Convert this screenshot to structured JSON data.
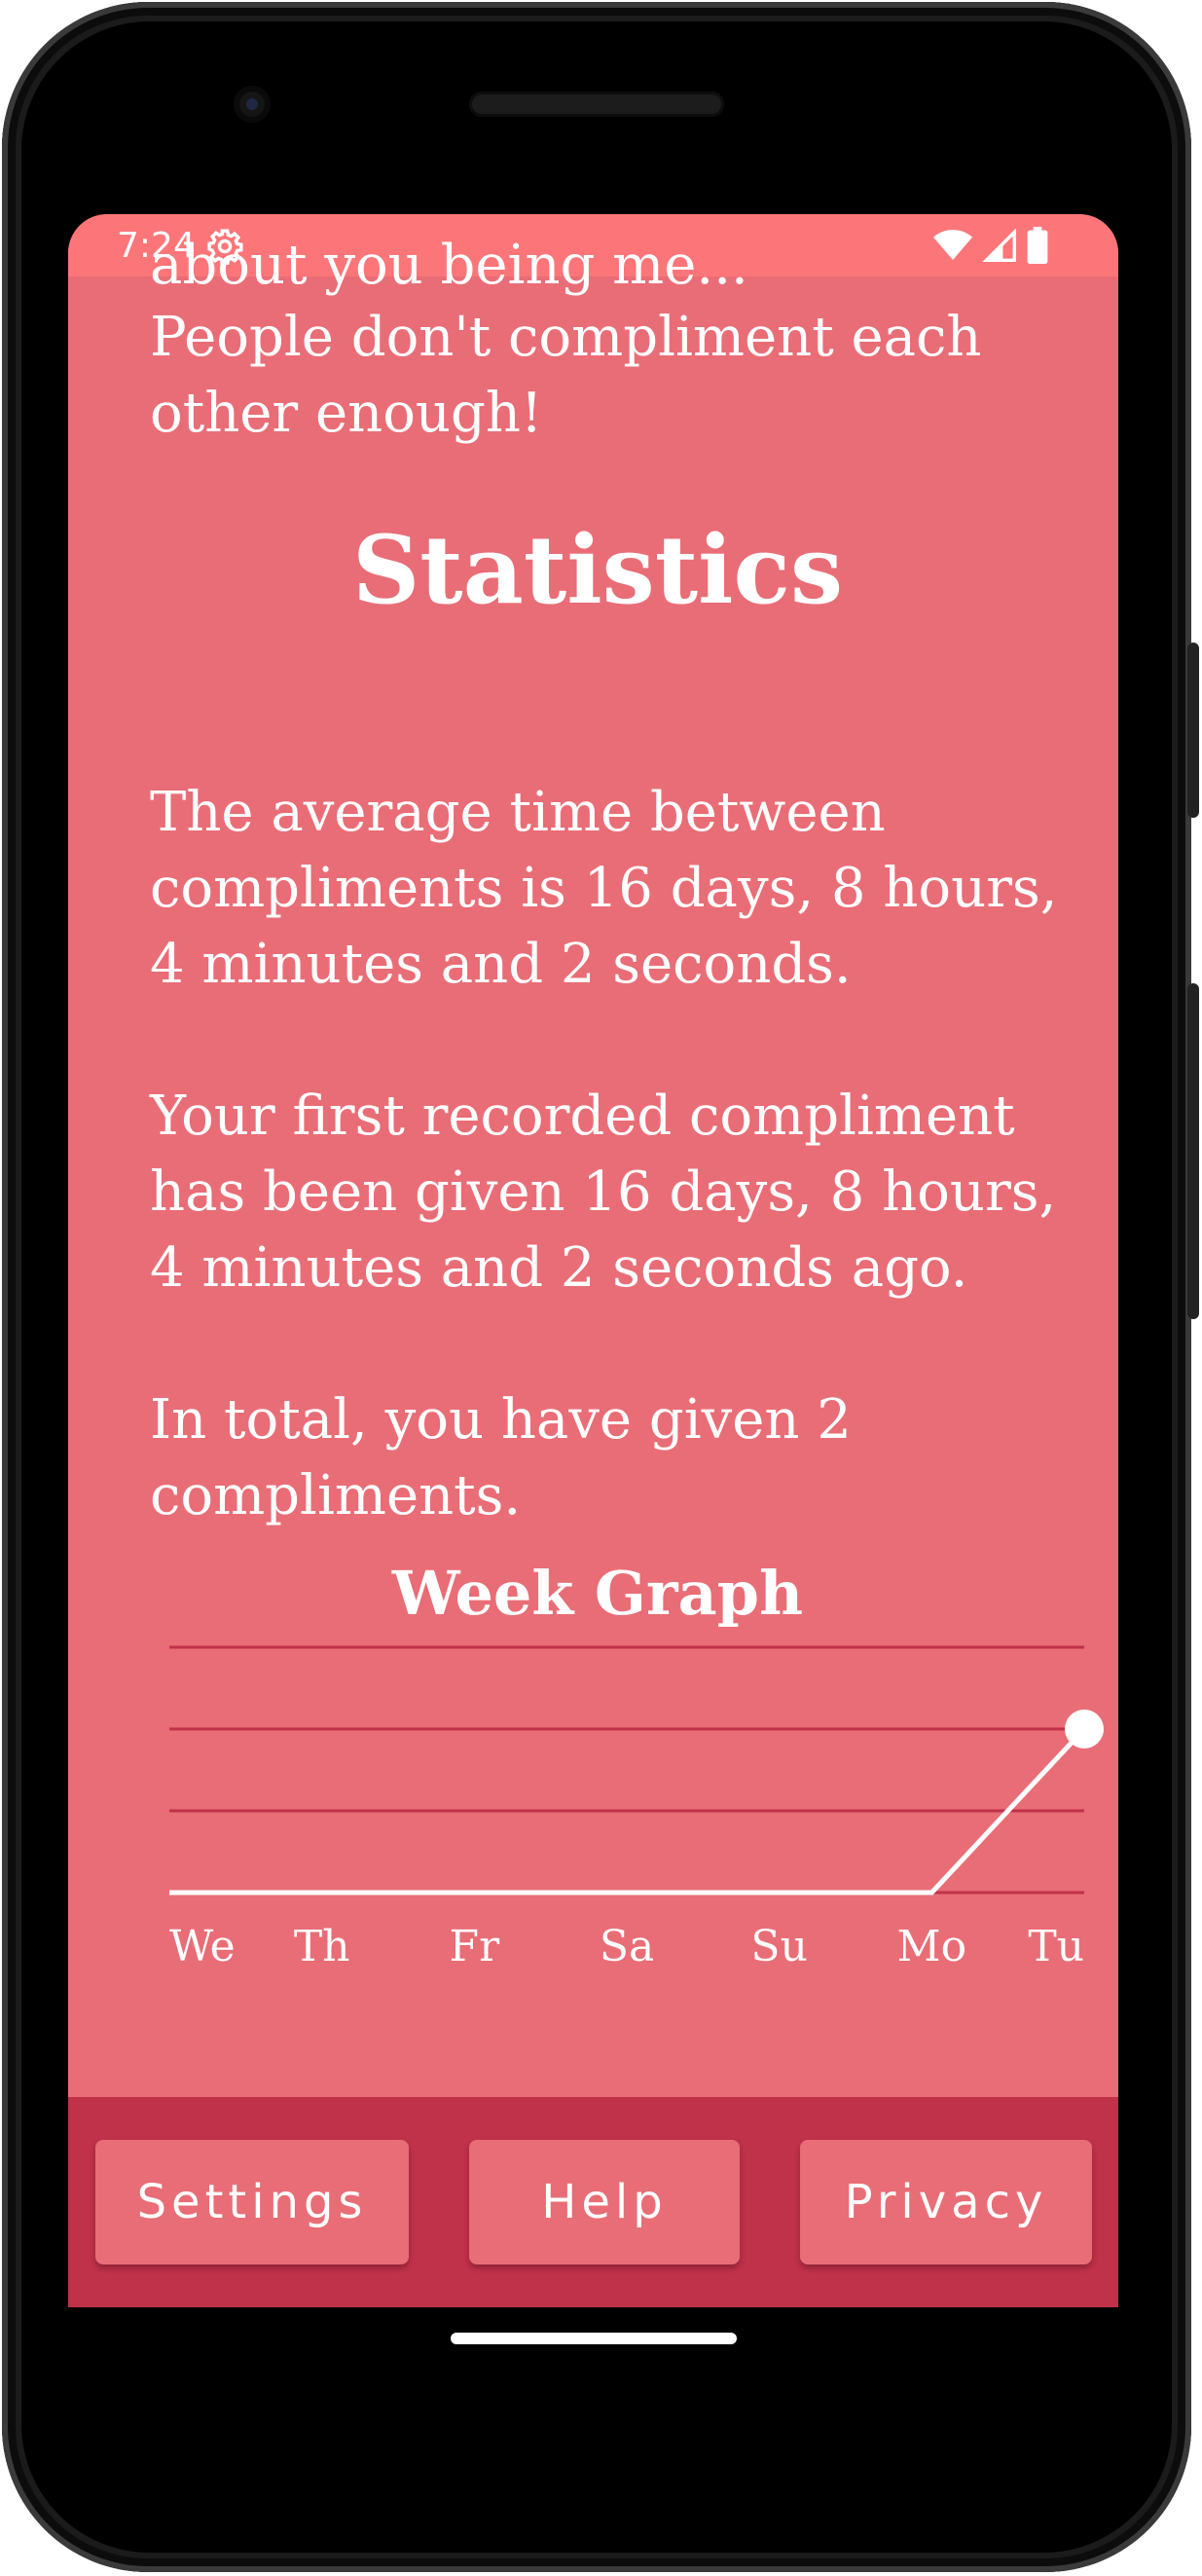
{
  "status_bar": {
    "time": "7:24",
    "icons": [
      "gear-icon",
      "wifi-icon",
      "signal-icon",
      "battery-icon"
    ]
  },
  "content": {
    "cut_off_line": "about you being me...",
    "intro": "People don't compliment each\nother enough!",
    "statistics_heading": "Statistics",
    "avg_time": "The average time between\ncompliments is 16 days, 8 hours,\n4 minutes and 2 seconds.",
    "first_compliment": "Your first recorded compliment\nhas been given 16 days, 8 hours,\n4 minutes and 2 seconds ago.",
    "total": "In total, you have given 2\ncompliments."
  },
  "chart_data": {
    "type": "line",
    "title": "Week Graph",
    "categories": [
      "We",
      "Th",
      "Fr",
      "Sa",
      "Su",
      "Mo",
      "Tu"
    ],
    "values": [
      0,
      0,
      0,
      0,
      0,
      0,
      2
    ],
    "ylim": [
      0,
      3
    ],
    "grid": true
  },
  "bottom_nav": {
    "settings": "Settings",
    "help": "Help",
    "privacy": "Privacy"
  },
  "colors": {
    "background": "#e96d76",
    "status_bar": "#fc7679",
    "bottom_bar": "#c0314a",
    "gridline": "#c0314a",
    "text": "#ffffff"
  }
}
